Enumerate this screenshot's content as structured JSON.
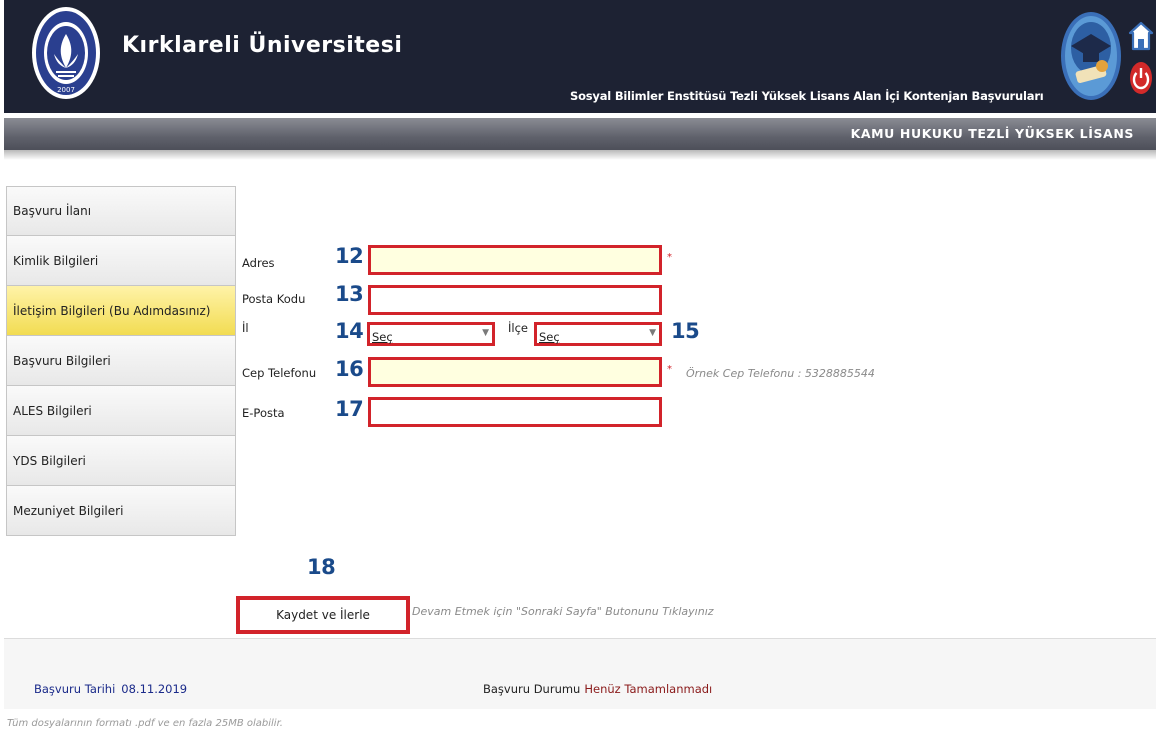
{
  "header": {
    "university_name": "Kırklareli Üniversitesi",
    "app_title": "Sosyal Bilimler Enstitüsü Tezli Yüksek Lisans Alan İçi Kontenjan Başvuruları",
    "logo_text_top": "KIRKLARELİ ÜNİVERSİTESİ",
    "logo_text_bottom": "2007",
    "icons": [
      "university-logo",
      "graduation-icon",
      "home-icon",
      "power-icon"
    ]
  },
  "program": {
    "name": "KAMU HUKUKU TEZLİ YÜKSEK LİSANS"
  },
  "sidebar": {
    "items": [
      {
        "label": "Başvuru İlanı"
      },
      {
        "label": "Kimlik Bilgileri"
      },
      {
        "label": "İletişim Bilgileri (Bu Adımdasınız)",
        "active": true
      },
      {
        "label": "Başvuru Bilgileri"
      },
      {
        "label": "ALES Bilgileri"
      },
      {
        "label": "YDS Bilgileri"
      },
      {
        "label": "Mezuniyet Bilgileri"
      }
    ]
  },
  "form": {
    "adres": {
      "label": "Adres",
      "number": "12",
      "value": "",
      "required": "*"
    },
    "posta_kodu": {
      "label": "Posta Kodu",
      "number": "13",
      "value": ""
    },
    "il": {
      "label": "İl",
      "number": "14",
      "selected": "Seç"
    },
    "ilce": {
      "label": "İlçe",
      "number": "15",
      "selected": "Seç"
    },
    "cep_telefonu": {
      "label": "Cep Telefonu",
      "number": "16",
      "value": "",
      "required": "*",
      "hint": "Örnek Cep Telefonu : 5328885544"
    },
    "e_posta": {
      "label": "E-Posta",
      "number": "17",
      "value": ""
    }
  },
  "actions": {
    "save": {
      "number": "18",
      "label": "Kaydet ve İlerle"
    },
    "continue_hint": "Devam Etmek için \"Sonraki Sayfa\" Butonunu Tıklayınız"
  },
  "footer": {
    "date_label": "Başvuru Tarihi",
    "date_value": "08.11.2019",
    "status_label": "Başvuru Durumu",
    "status_value": "Henüz Tamamlanmadı"
  },
  "note": "Tüm dosyalarının formatı .pdf ve en fazla 25MB olabilir.",
  "colors": {
    "header_bg": "#1d2233",
    "highlight_border": "#d2232a",
    "active_item": "#f2dc52",
    "required_field_bg": "#ffffe0",
    "number_blue": "#1a4a8a"
  }
}
